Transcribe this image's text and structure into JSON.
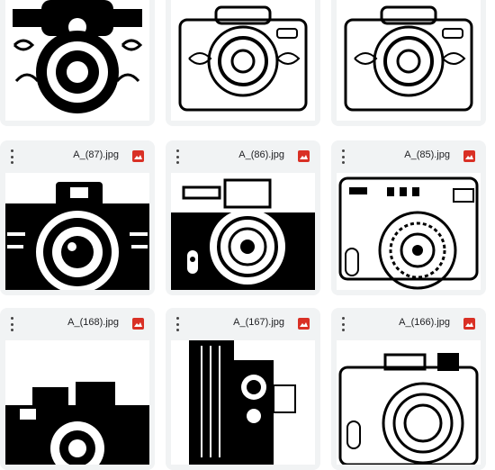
{
  "files": [
    {
      "name": "A_(87).jpg",
      "icon": "image-file-icon"
    },
    {
      "name": "A_(86).jpg",
      "icon": "image-file-icon"
    },
    {
      "name": "A_(85).jpg",
      "icon": "image-file-icon"
    },
    {
      "name": "A_(168).jpg",
      "icon": "image-file-icon"
    },
    {
      "name": "A_(167).jpg",
      "icon": "image-file-icon"
    },
    {
      "name": "A_(166).jpg",
      "icon": "image-file-icon"
    }
  ],
  "colors": {
    "card_bg": "#f1f3f4",
    "image_icon": "#d93025"
  }
}
